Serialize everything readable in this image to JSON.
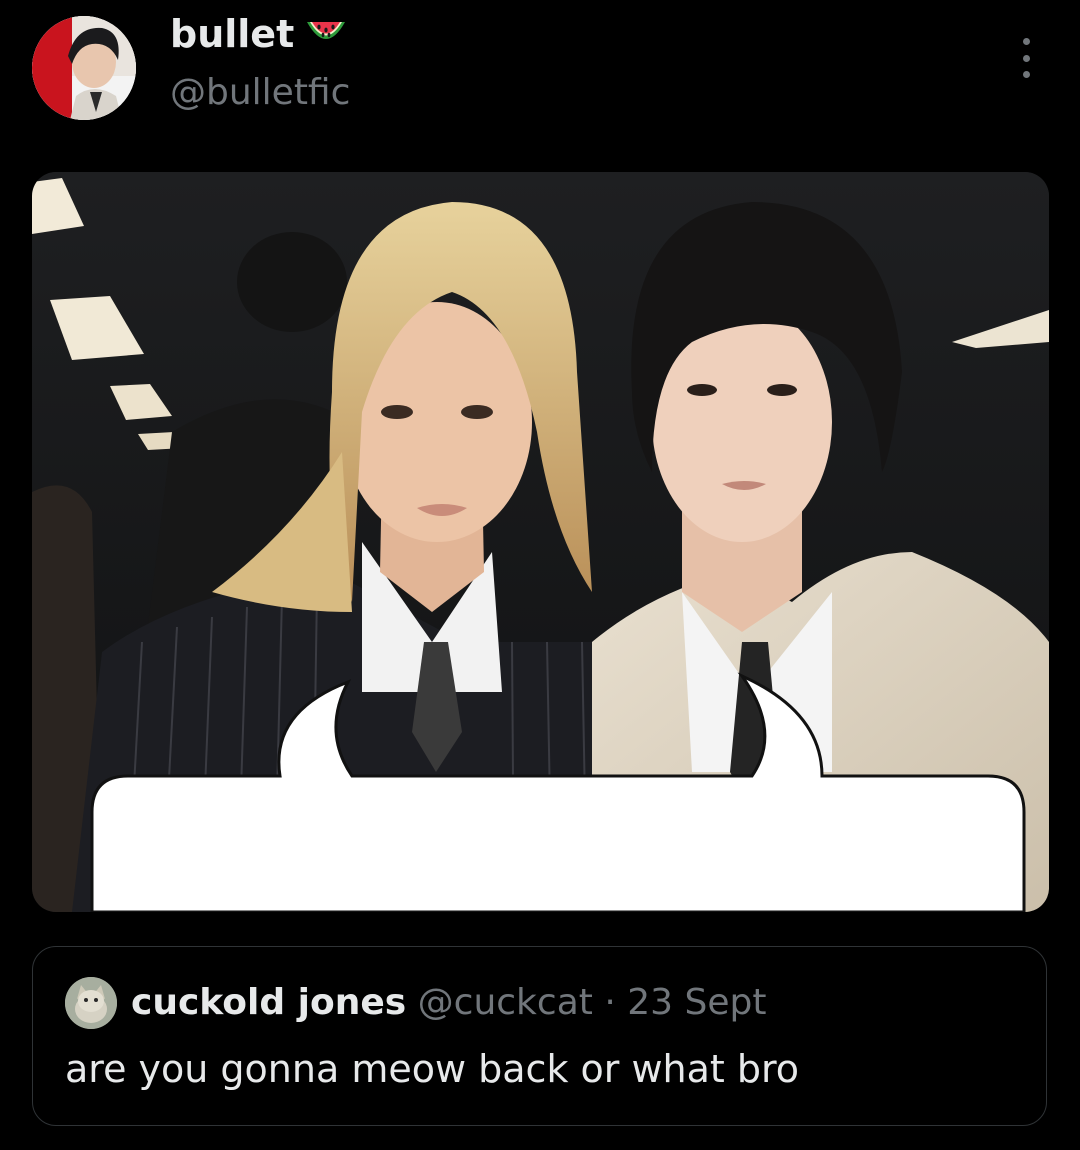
{
  "author": {
    "display_name": "bullet",
    "name_emoji": "watermelon-icon",
    "handle": "@bulletfic"
  },
  "icons": {
    "more": "more-options-icon"
  },
  "media": {
    "description_icon": "photo"
  },
  "quoted_tweet": {
    "display_name": "cuckold jones",
    "handle": "@cuckcat",
    "separator": "·",
    "date": "23 Sept",
    "text": "are you gonna meow back or what bro"
  },
  "colors": {
    "background": "#000000",
    "primary_text": "#e7e9ea",
    "secondary_text": "#71767b",
    "border": "#2f3336"
  }
}
